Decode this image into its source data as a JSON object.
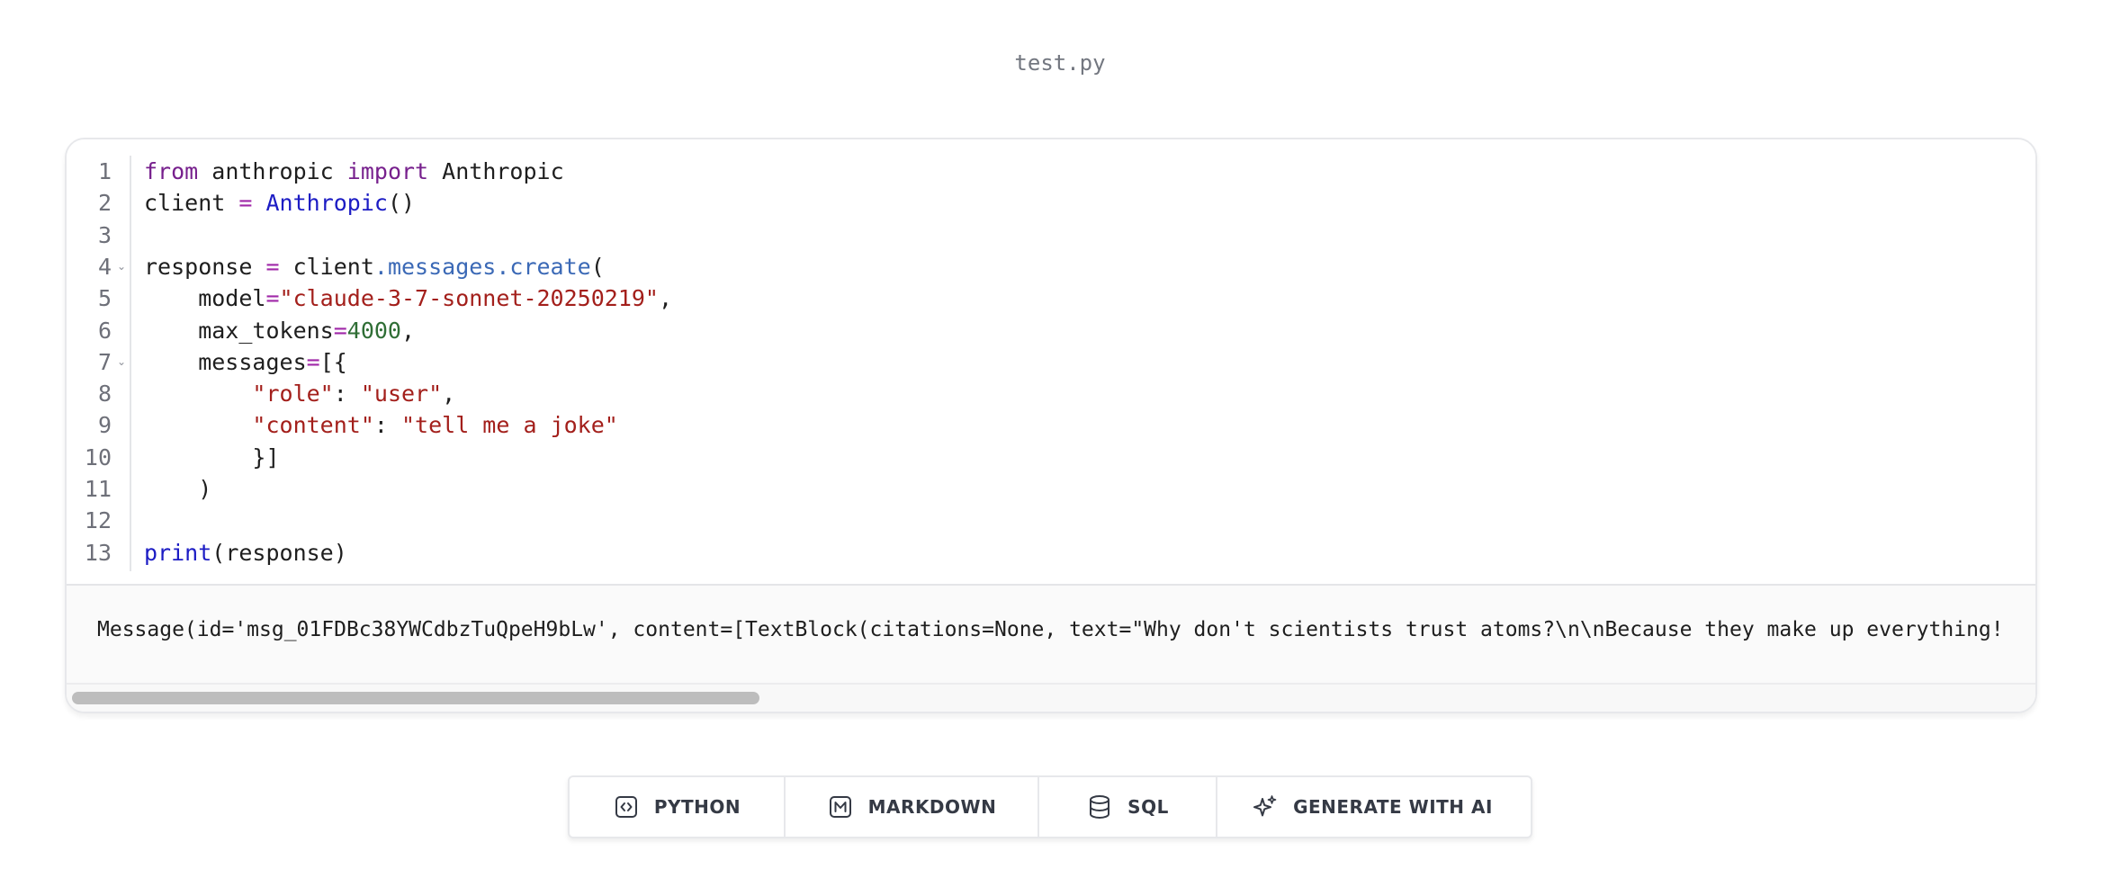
{
  "file": {
    "title": "test.py"
  },
  "editor": {
    "line_numbers": [
      "1",
      "2",
      "3",
      "4",
      "5",
      "6",
      "7",
      "8",
      "9",
      "10",
      "11",
      "12",
      "13"
    ],
    "fold_lines": [
      4,
      7
    ],
    "fold_icon": "chevron-down-icon",
    "lines": [
      [
        {
          "t": "kw",
          "v": "from"
        },
        {
          "t": "plain",
          "v": " anthropic "
        },
        {
          "t": "kw",
          "v": "import"
        },
        {
          "t": "plain",
          "v": " Anthropic"
        }
      ],
      [
        {
          "t": "plain",
          "v": "client "
        },
        {
          "t": "op",
          "v": "="
        },
        {
          "t": "plain",
          "v": " "
        },
        {
          "t": "fn",
          "v": "Anthropic"
        },
        {
          "t": "plain",
          "v": "()"
        }
      ],
      [],
      [
        {
          "t": "plain",
          "v": "response "
        },
        {
          "t": "op",
          "v": "="
        },
        {
          "t": "plain",
          "v": " client"
        },
        {
          "t": "attr",
          "v": ".messages.create"
        },
        {
          "t": "plain",
          "v": "("
        }
      ],
      [
        {
          "t": "plain",
          "v": "    model"
        },
        {
          "t": "op",
          "v": "="
        },
        {
          "t": "str",
          "v": "\"claude-3-7-sonnet-20250219\""
        },
        {
          "t": "plain",
          "v": ","
        }
      ],
      [
        {
          "t": "plain",
          "v": "    max_tokens"
        },
        {
          "t": "op",
          "v": "="
        },
        {
          "t": "num",
          "v": "4000"
        },
        {
          "t": "plain",
          "v": ","
        }
      ],
      [
        {
          "t": "plain",
          "v": "    messages"
        },
        {
          "t": "op",
          "v": "="
        },
        {
          "t": "plain",
          "v": "[{"
        }
      ],
      [
        {
          "t": "plain",
          "v": "        "
        },
        {
          "t": "str",
          "v": "\"role\""
        },
        {
          "t": "plain",
          "v": ": "
        },
        {
          "t": "str",
          "v": "\"user\""
        },
        {
          "t": "plain",
          "v": ","
        }
      ],
      [
        {
          "t": "plain",
          "v": "        "
        },
        {
          "t": "str",
          "v": "\"content\""
        },
        {
          "t": "plain",
          "v": ": "
        },
        {
          "t": "str",
          "v": "\"tell me a joke\""
        }
      ],
      [
        {
          "t": "plain",
          "v": "        }]"
        }
      ],
      [
        {
          "t": "plain",
          "v": "    )"
        }
      ],
      [],
      [
        {
          "t": "fn",
          "v": "print"
        },
        {
          "t": "plain",
          "v": "(response)"
        }
      ]
    ]
  },
  "output": {
    "text": "Message(id='msg_01FDBc38YWCdbzTuQpeH9bLw', content=[TextBlock(citations=None, text=\"Why don't scientists trust atoms?\\n\\nBecause they make up everything!"
  },
  "toolbar": {
    "buttons": [
      {
        "name": "python-button",
        "icon": "code-icon",
        "label": "PYTHON"
      },
      {
        "name": "markdown-button",
        "icon": "markdown-icon",
        "label": "MARKDOWN"
      },
      {
        "name": "sql-button",
        "icon": "database-icon",
        "label": "SQL"
      },
      {
        "name": "generate-ai-button",
        "icon": "sparkles-icon",
        "label": "GENERATE WITH AI"
      }
    ]
  },
  "colors": {
    "keyword": "#77208d",
    "function": "#1c1cc4",
    "operator": "#a028a8",
    "attribute": "#3b69b6",
    "string": "#a31f1b",
    "number": "#2f6e35"
  }
}
